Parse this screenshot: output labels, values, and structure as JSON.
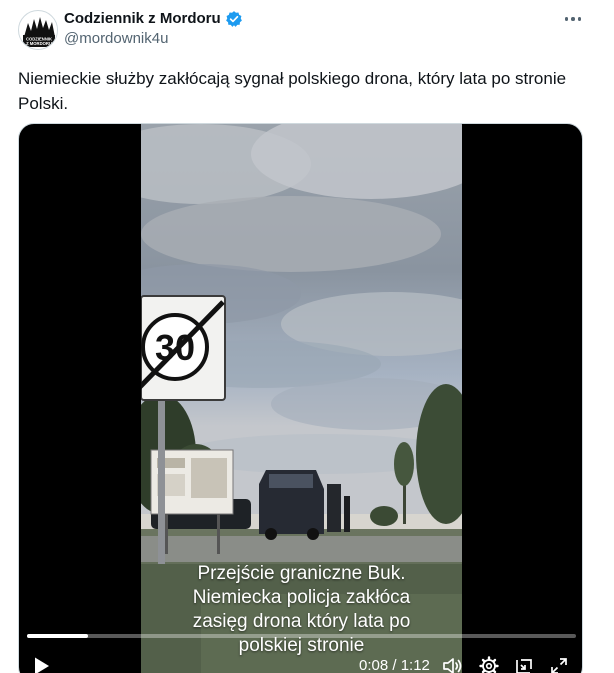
{
  "author": {
    "name": "Codziennik z Mordoru",
    "handle": "@mordownik4u",
    "avatar_text_line1": "CODZIENNIK",
    "avatar_text_line2": "Z MORDORU",
    "verified_color": "#1d9bf0"
  },
  "tweet": {
    "text": "Niemieckie służby zakłócają sygnał polskiego drona, który lata po stronie Polski."
  },
  "video": {
    "caption_lines": [
      "Przejście graniczne Buk.",
      "Niemiecka policja zakłóca",
      "zasięg drona który lata po",
      "polskiej stronie"
    ],
    "sign_speed": "30",
    "time_display": "0:08 / 1:12",
    "progress": 0.111
  },
  "icons": {
    "more": "more-icon",
    "play": "play-icon",
    "volume": "volume-icon",
    "settings": "settings-icon",
    "pip": "picture-in-picture-icon",
    "fullscreen": "fullscreen-icon",
    "verified": "verified-badge-icon"
  },
  "colors": {
    "text_primary": "#0f1419",
    "text_secondary": "#536471",
    "border": "#cfd9de"
  }
}
